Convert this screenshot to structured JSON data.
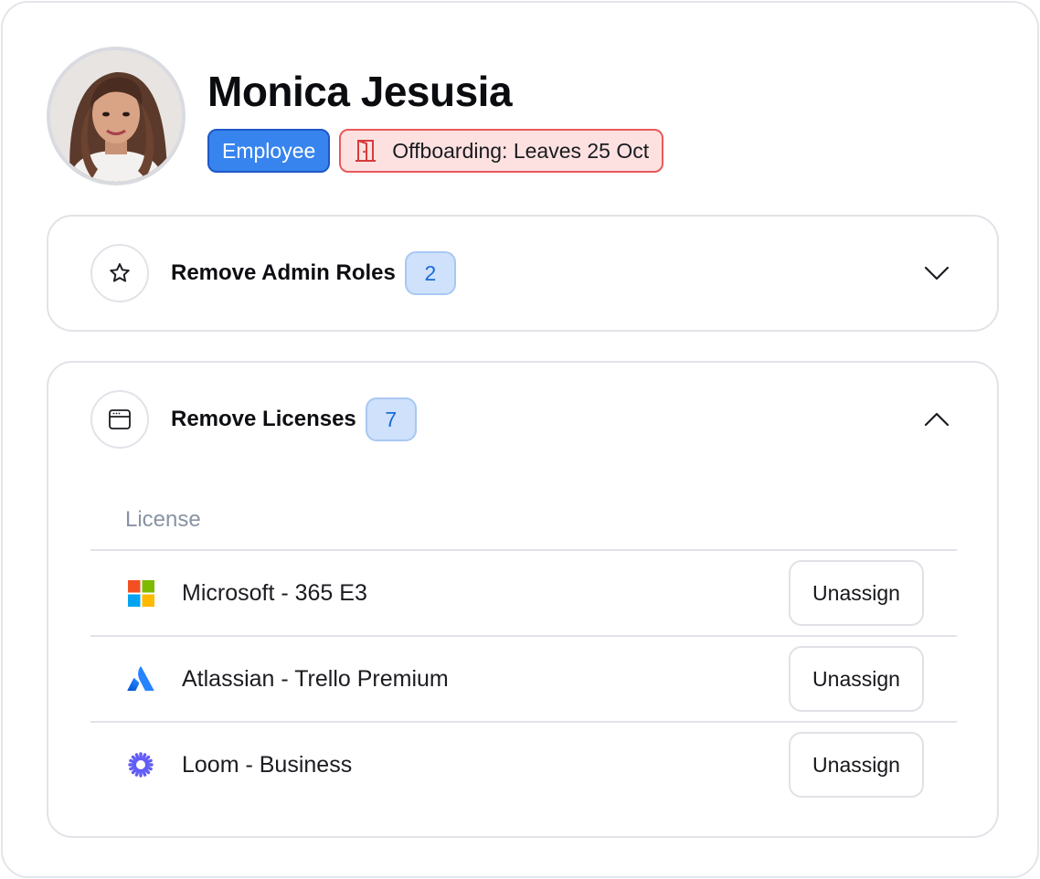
{
  "user": {
    "name": "Monica Jesusia",
    "role_badge": "Employee",
    "status_badge": "Offboarding: Leaves 25 Oct",
    "avatar_icon": "user-photo"
  },
  "sections": [
    {
      "title": "Remove Admin Roles",
      "count": "2",
      "icon": "star-icon",
      "state": "collapsed"
    },
    {
      "title": "Remove Licenses",
      "count": "7",
      "icon": "browser-window-icon",
      "state": "expanded",
      "column_header": "License",
      "rows": [
        {
          "label": "Microsoft - 365 E3",
          "icon": "microsoft-logo-icon",
          "action": "Unassign"
        },
        {
          "label": "Atlassian - Trello Premium",
          "icon": "atlassian-logo-icon",
          "action": "Unassign"
        },
        {
          "label": "Loom - Business",
          "icon": "loom-logo-icon",
          "action": "Unassign"
        }
      ]
    }
  ],
  "colors": {
    "accent_blue": "#3784ee",
    "danger_red": "#e85a5a",
    "count_bg": "#cfe1fb",
    "muted_text": "#8893a3"
  }
}
